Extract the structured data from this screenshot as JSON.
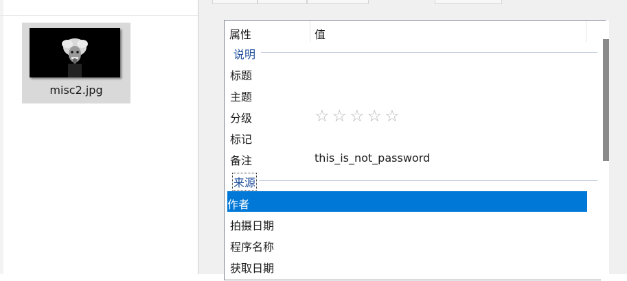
{
  "explorer": {
    "file": {
      "name": "misc2.jpg"
    }
  },
  "properties": {
    "headers": {
      "property": "属性",
      "value": "值"
    },
    "groups": {
      "description": "说明",
      "origin": "来源"
    },
    "description_rows": [
      {
        "key": "标题",
        "value": ""
      },
      {
        "key": "主题",
        "value": ""
      },
      {
        "key": "分级",
        "value": "☆☆☆☆☆"
      },
      {
        "key": "标记",
        "value": ""
      },
      {
        "key": "备注",
        "value": "this_is_not_password"
      }
    ],
    "origin_rows": [
      {
        "key": "作者",
        "value": "",
        "selected": true
      },
      {
        "key": "拍摄日期",
        "value": ""
      },
      {
        "key": "程序名称",
        "value": ""
      },
      {
        "key": "获取日期",
        "value": ""
      }
    ],
    "rating": {
      "stars_filled": 0,
      "stars_total": 5
    }
  },
  "colors": {
    "selection": "#0078d7",
    "group_text": "#1f4e9c"
  }
}
